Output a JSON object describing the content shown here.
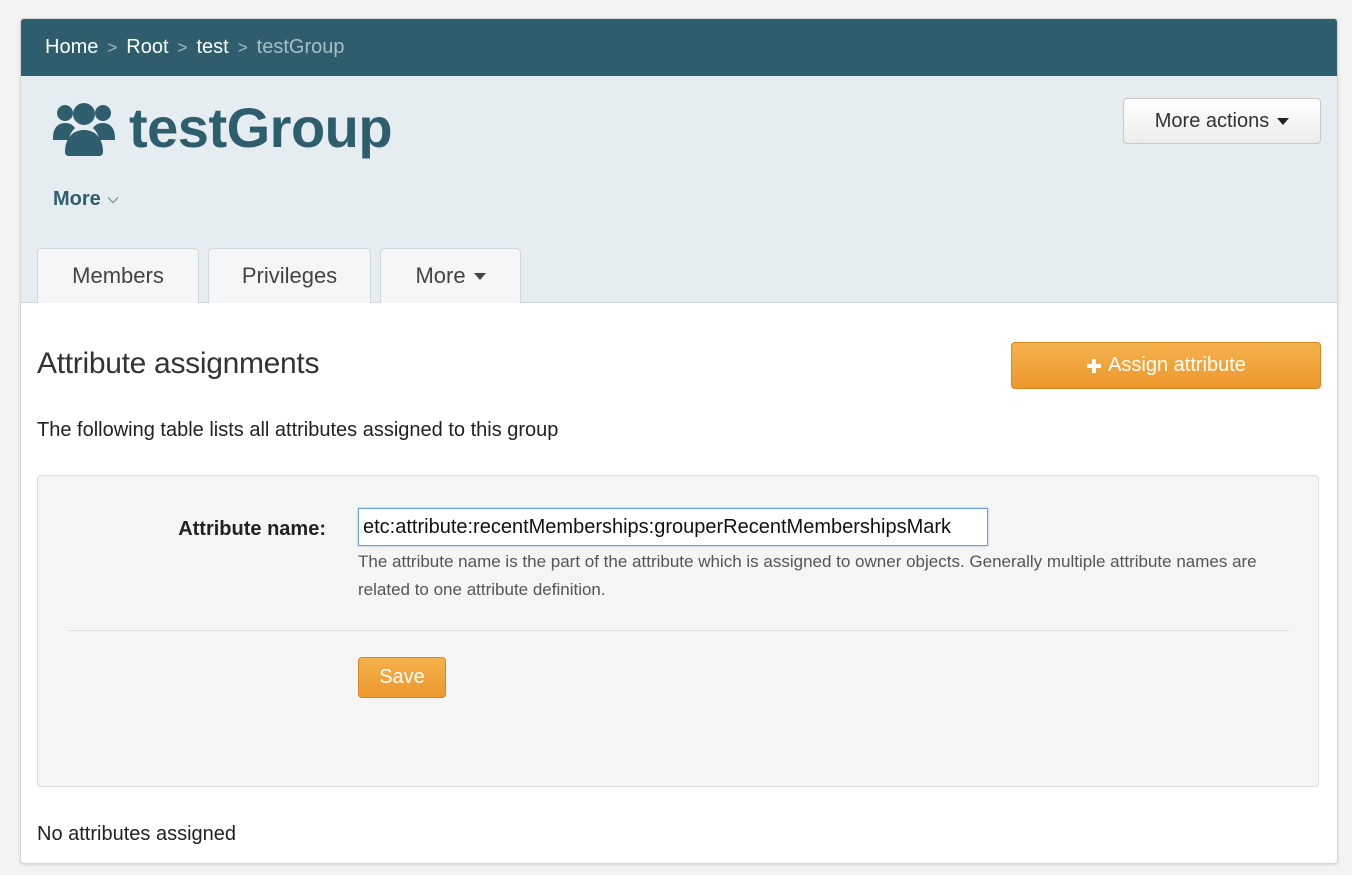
{
  "breadcrumb": {
    "items": [
      "Home",
      "Root",
      "test",
      "testGroup"
    ]
  },
  "header": {
    "title": "testGroup",
    "title_icon": "users-icon",
    "more_actions_label": "More actions",
    "more_link_label": "More"
  },
  "tabs": [
    {
      "label": "Members"
    },
    {
      "label": "Privileges"
    },
    {
      "label": "More"
    }
  ],
  "section": {
    "title": "Attribute assignments",
    "assign_button_label": "Assign attribute",
    "description": "The following table lists all attributes assigned to this group"
  },
  "form": {
    "attribute_name_label": "Attribute name:",
    "attribute_name_value": "etc:attribute:recentMemberships:grouperRecentMembershipsMark",
    "help_text": "The attribute name is the part of the attribute which is assigned to owner objects. Generally multiple attribute names are related to one attribute definition.",
    "save_label": "Save"
  },
  "empty_state": "No attributes assigned",
  "colors": {
    "brand": "#2e5e6e",
    "header_bg": "#e6edf1",
    "accent_orange": "#ec982c"
  }
}
